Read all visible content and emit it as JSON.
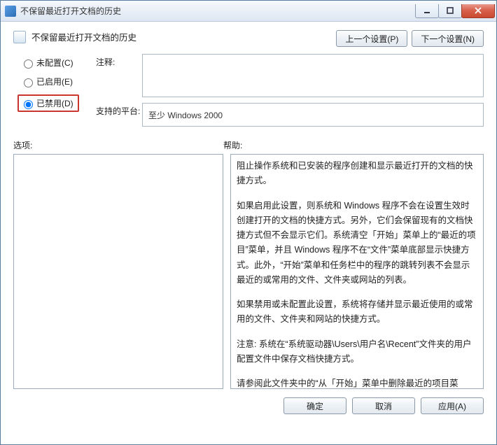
{
  "window": {
    "title": "不保留最近打开文档的历史"
  },
  "header": {
    "title": "不保留最近打开文档的历史",
    "prev_label": "上一个设置(P)",
    "next_label": "下一个设置(N)"
  },
  "radios": {
    "not_configured": "未配置(C)",
    "enabled": "已启用(E)",
    "disabled": "已禁用(D)",
    "selected": "disabled"
  },
  "fields": {
    "comment_label": "注释:",
    "comment_value": "",
    "platform_label": "支持的平台:",
    "platform_value": "至少 Windows 2000"
  },
  "panes": {
    "options_label": "选项:",
    "help_label": "帮助:"
  },
  "help_paragraphs": [
    "阻止操作系统和已安装的程序创建和显示最近打开的文档的快捷方式。",
    "如果启用此设置，则系统和 Windows 程序不会在设置生效时创建打开的文档的快捷方式。另外，它们会保留现有的文档快捷方式但不会显示它们。系统清空「开始」菜单上的“最近的项目”菜单，并且 Windows 程序不在“文件”菜单底部显示快捷方式。此外，“开始”菜单和任务栏中的程序的跳转列表不会显示最近的或常用的文件、文件夹或网站的列表。",
    "如果禁用或未配置此设置，系统将存储并显示最近使用的或常用的文件、文件夹和网站的快捷方式。",
    "注意: 系统在“系统驱动器\\Users\\用户名\\Recent”文件夹的用户配置文件中保存文档快捷方式。",
    "请参阅此文件夹中的“从「开始」菜单中删除最近的项目菜单”策略和“退出时清除最近打开的文档的历史”策略。"
  ],
  "footer": {
    "ok": "确定",
    "cancel": "取消",
    "apply": "应用(A)"
  }
}
